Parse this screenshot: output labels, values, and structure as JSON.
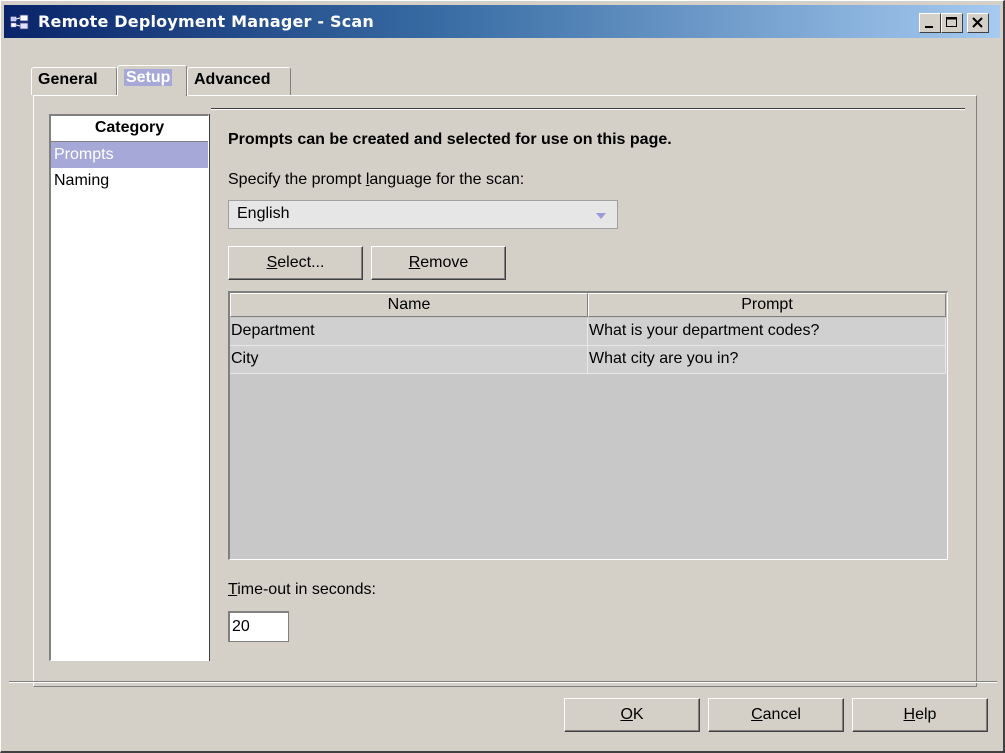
{
  "window": {
    "title": "Remote Deployment Manager - Scan",
    "controls": [
      "minimize",
      "maximize",
      "close"
    ]
  },
  "tabs": [
    {
      "label": "General",
      "active": false
    },
    {
      "label": "Setup",
      "active": true
    },
    {
      "label": "Advanced",
      "active": false
    }
  ],
  "category": {
    "header": "Category",
    "items": [
      {
        "label": "Prompts",
        "selected": true
      },
      {
        "label": "Naming",
        "selected": false
      }
    ]
  },
  "content": {
    "heading": "Prompts can be created and selected for use on this page.",
    "language_label_pre": "Specify the prompt ",
    "language_label_mnemonic": "l",
    "language_label_post": "anguage for the scan:",
    "language_value": "English",
    "select_button": {
      "mnemonic": "S",
      "rest": "elect..."
    },
    "remove_button": {
      "mnemonic": "R",
      "rest": "emove"
    },
    "grid": {
      "columns": [
        "Name",
        "Prompt"
      ],
      "rows": [
        [
          "Department",
          "What is your department codes?"
        ],
        [
          "City",
          "What city are you in?"
        ]
      ]
    },
    "timeout_label": {
      "mnemonic": "T",
      "rest": "ime-out in seconds:"
    },
    "timeout_value": "20"
  },
  "footer": {
    "ok_button": {
      "mnemonic": "O",
      "rest": "K"
    },
    "cancel_button": {
      "mnemonic": "C",
      "rest": "ancel"
    },
    "help_button": {
      "mnemonic": "H",
      "rest": "elp"
    }
  },
  "colors": {
    "face": "#d4d0c8",
    "titlebar_start": "#0a246a",
    "titlebar_end": "#a6caf0",
    "selection": "#a6a8d8",
    "grid_background": "#c8c8c8"
  },
  "icons": [
    "app-network-icon",
    "minimize-icon",
    "maximize-icon",
    "close-icon",
    "chevron-down-icon"
  ]
}
